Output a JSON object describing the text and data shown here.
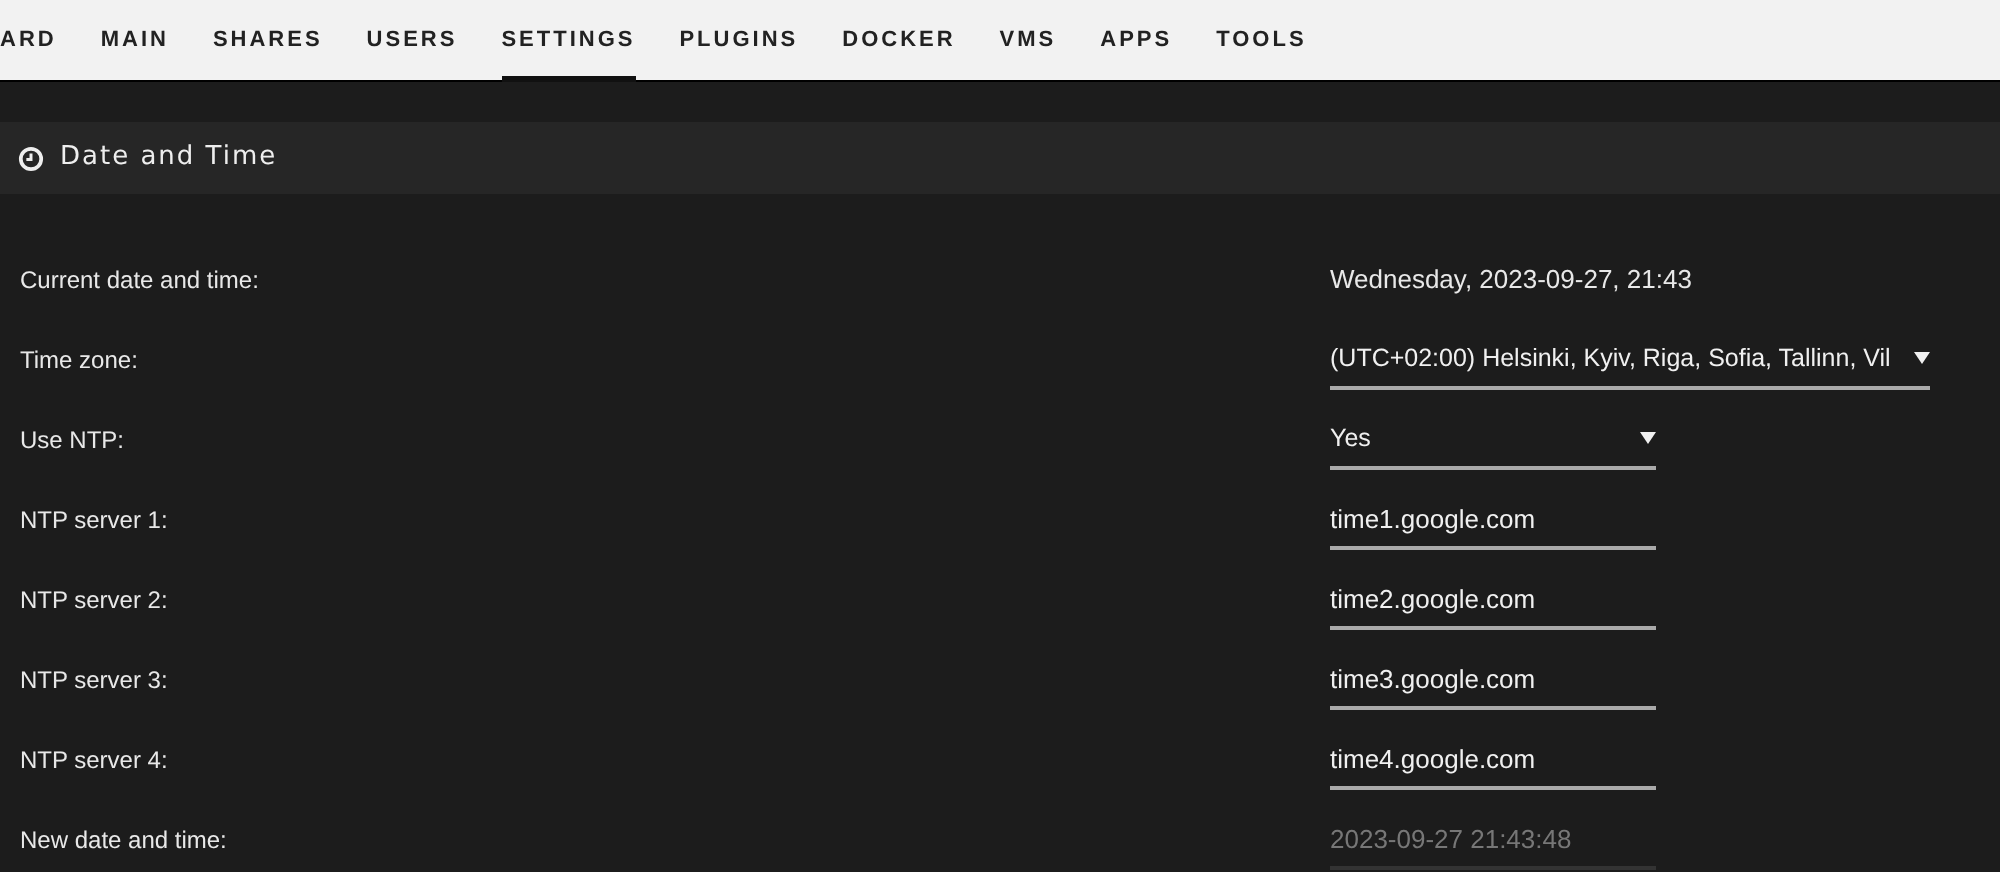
{
  "nav": [
    {
      "label": "ARD",
      "selected": false
    },
    {
      "label": "MAIN",
      "selected": false
    },
    {
      "label": "SHARES",
      "selected": false
    },
    {
      "label": "USERS",
      "selected": false
    },
    {
      "label": "SETTINGS",
      "selected": true
    },
    {
      "label": "PLUGINS",
      "selected": false
    },
    {
      "label": "DOCKER",
      "selected": false
    },
    {
      "label": "VMS",
      "selected": false
    },
    {
      "label": "APPS",
      "selected": false
    },
    {
      "label": "TOOLS",
      "selected": false
    }
  ],
  "panel": {
    "title": "Date and Time"
  },
  "rows": [
    {
      "label": "Current date and time:",
      "kind": "text",
      "value": "Wednesday, 2023-09-27, 21:43"
    },
    {
      "label": "Time zone:",
      "kind": "wide-select",
      "value": "(UTC+02:00) Helsinki, Kyiv, Riga, Sofia, Tallinn, Vil"
    },
    {
      "label": "Use NTP:",
      "kind": "select",
      "value": "Yes"
    },
    {
      "label": "NTP server 1:",
      "kind": "input",
      "disabled": false,
      "value": "time1.google.com"
    },
    {
      "label": "NTP server 2:",
      "kind": "input",
      "disabled": false,
      "value": "time2.google.com"
    },
    {
      "label": "NTP server 3:",
      "kind": "input",
      "disabled": false,
      "value": "time3.google.com"
    },
    {
      "label": "NTP server 4:",
      "kind": "input",
      "disabled": false,
      "value": "time4.google.com"
    },
    {
      "label": "New date and time:",
      "kind": "input",
      "disabled": true,
      "value": "2023-09-27 21:43:48"
    }
  ]
}
